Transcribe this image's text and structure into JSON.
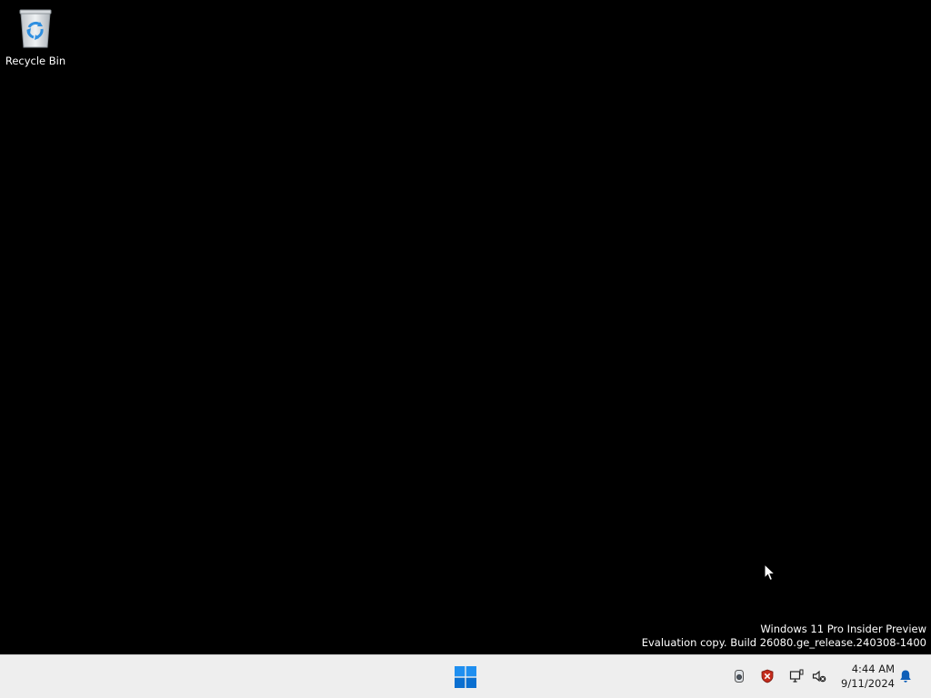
{
  "desktop": {
    "background_color": "#000000",
    "icons": [
      {
        "label": "Recycle Bin",
        "icon": "recycle-bin-icon"
      }
    ],
    "watermark": {
      "line1": "Windows 11 Pro Insider Preview",
      "line2": "Evaluation copy. Build 26080.ge_release.240308-1400"
    }
  },
  "taskbar": {
    "background_color": "#eeeeee",
    "start_icon": "windows-logo-icon",
    "accent_color": "#0078d4",
    "tray_icons": [
      "camera-icon",
      "defender-shield-icon",
      "display-icon",
      "speaker-muted-icon"
    ],
    "clock": {
      "time": "4:44 AM",
      "date": "9/11/2024"
    },
    "notification_icon": "bell-icon"
  }
}
